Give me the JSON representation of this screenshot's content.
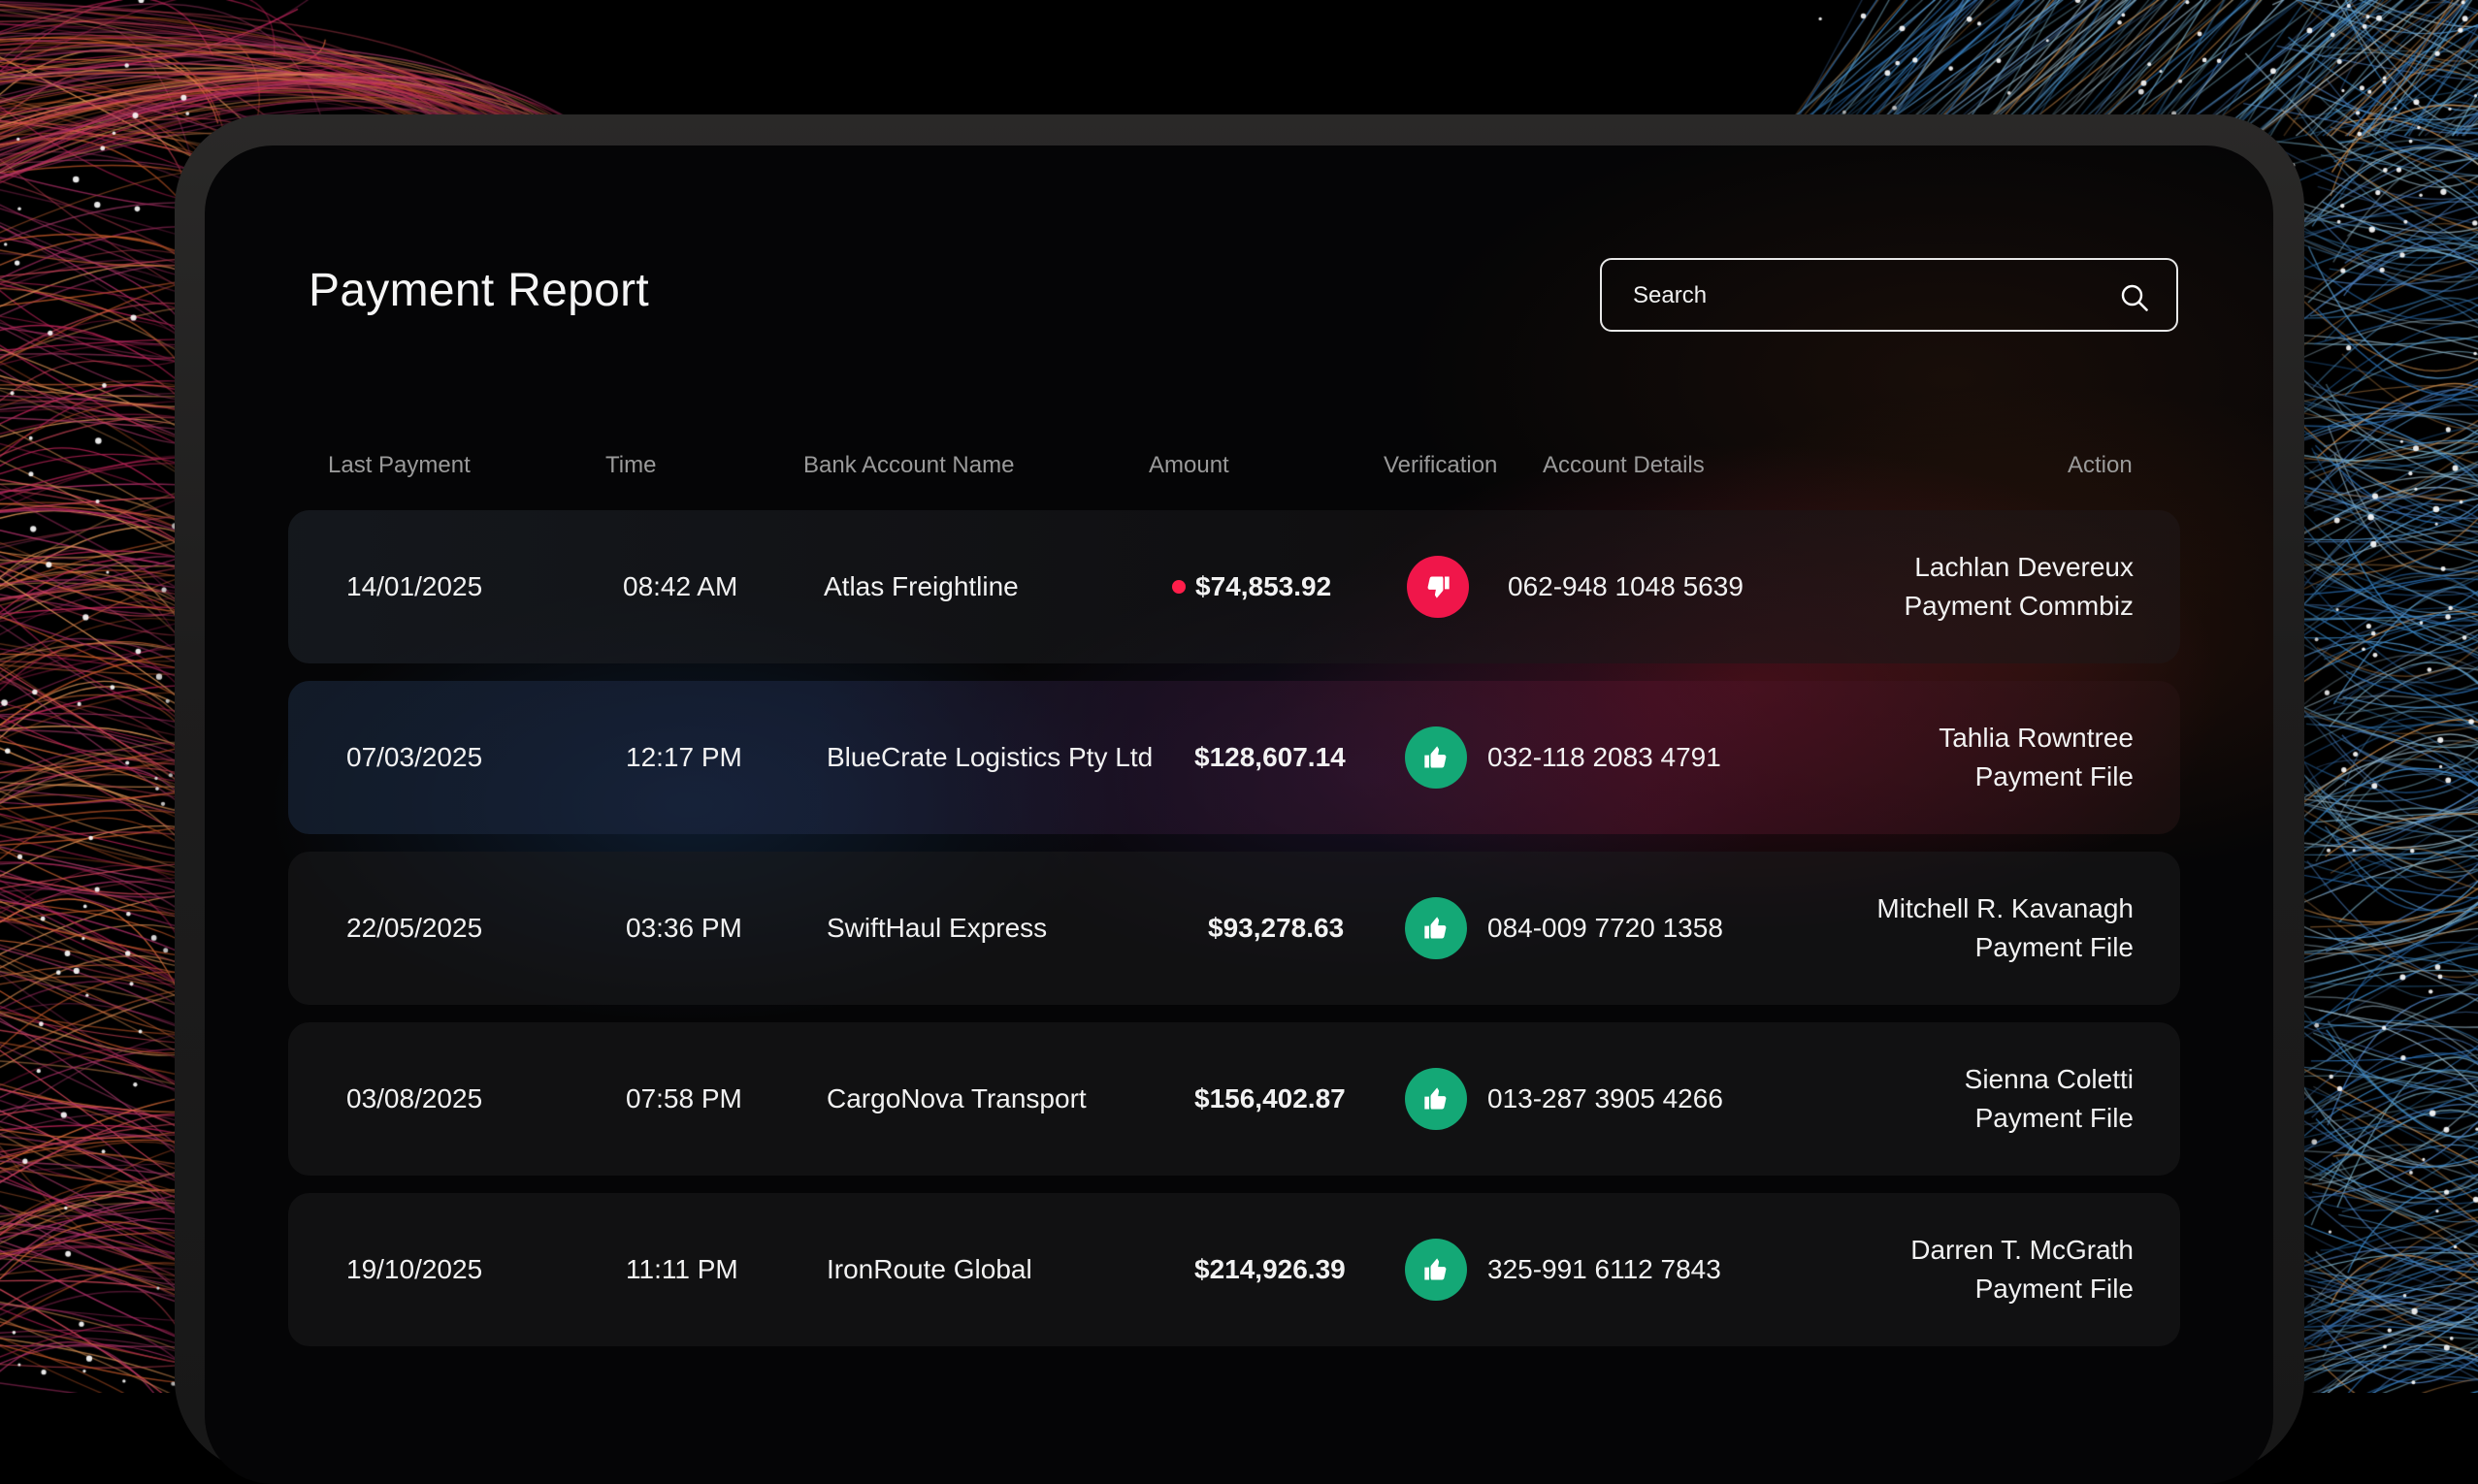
{
  "title": "Payment Report",
  "search": {
    "placeholder": "Search",
    "icon": "search-icon"
  },
  "columns": [
    "Last Payment",
    "Time",
    "Bank Account Name",
    "Amount",
    "Verification",
    "Account Details",
    "Action"
  ],
  "rows": [
    {
      "date": "14/01/2025",
      "time": "08:42 AM",
      "name": "Atlas Freightline",
      "amount": "$74,853.92",
      "flagged": true,
      "verification": "rejected",
      "account": "062-948 1048 5639",
      "action_name": "Lachlan Devereux",
      "action_file": "Payment Commbiz"
    },
    {
      "date": "07/03/2025",
      "time": "12:17 PM",
      "name": "BlueCrate Logistics Pty Ltd",
      "amount": "$128,607.14",
      "flagged": false,
      "verification": "approved",
      "account": "032-118  2083 4791",
      "action_name": "Tahlia Rowntree",
      "action_file": "Payment File"
    },
    {
      "date": "22/05/2025",
      "time": "03:36 PM",
      "name": "SwiftHaul Express",
      "amount": "$93,278.63",
      "flagged": false,
      "verification": "approved",
      "account": "084-009 7720 1358",
      "action_name": "Mitchell R. Kavanagh",
      "action_file": "Payment File"
    },
    {
      "date": "03/08/2025",
      "time": "07:58 PM",
      "name": "CargoNova Transport",
      "amount": "$156,402.87",
      "flagged": false,
      "verification": "approved",
      "account": "013-287 3905 4266",
      "action_name": "Sienna Coletti",
      "action_file": "Payment File"
    },
    {
      "date": "19/10/2025",
      "time": "11:11 PM",
      "name": "IronRoute Global",
      "amount": "$214,926.39",
      "flagged": false,
      "verification": "approved",
      "account": "325-991 6112 7843",
      "action_name": "Darren T. McGrath",
      "action_file": "Payment File"
    }
  ],
  "colors": {
    "approved": "#14a876",
    "rejected": "#f0164a",
    "flag_dot": "#ff1e4a"
  },
  "icons": {
    "approved": "thumbs-up-icon",
    "rejected": "thumbs-down-icon"
  }
}
